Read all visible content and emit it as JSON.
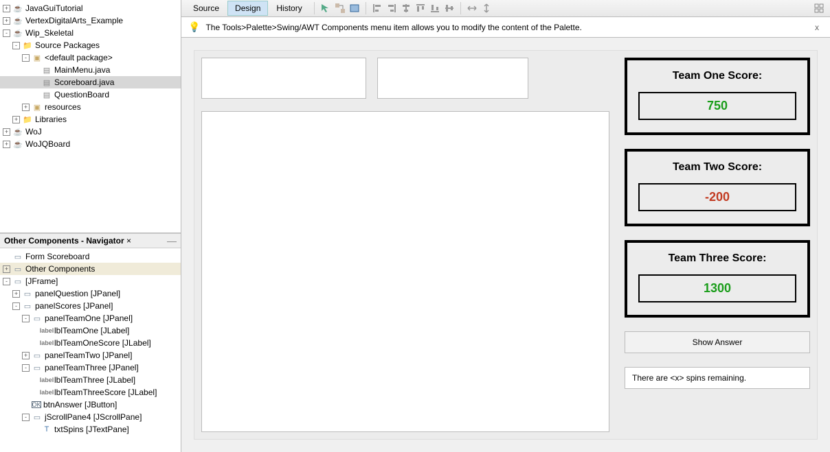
{
  "projects": {
    "items": [
      {
        "indent": 0,
        "toggle": "+",
        "icon": "java",
        "label": "JavaGuiTutorial"
      },
      {
        "indent": 0,
        "toggle": "+",
        "icon": "java",
        "label": "VertexDigitalArts_Example"
      },
      {
        "indent": 0,
        "toggle": "-",
        "icon": "java",
        "label": "Wip_Skeletal"
      },
      {
        "indent": 1,
        "toggle": "-",
        "icon": "folder",
        "label": "Source Packages"
      },
      {
        "indent": 2,
        "toggle": "-",
        "icon": "pkg",
        "label": "<default package>"
      },
      {
        "indent": 3,
        "toggle": "",
        "icon": "file",
        "label": "MainMenu.java"
      },
      {
        "indent": 3,
        "toggle": "",
        "icon": "file",
        "label": "Scoreboard.java",
        "selected": true
      },
      {
        "indent": 3,
        "toggle": "",
        "icon": "file",
        "label": "QuestionBoard"
      },
      {
        "indent": 2,
        "toggle": "+",
        "icon": "pkg",
        "label": "resources"
      },
      {
        "indent": 1,
        "toggle": "+",
        "icon": "folder",
        "label": "Libraries"
      },
      {
        "indent": 0,
        "toggle": "+",
        "icon": "java",
        "label": "WoJ"
      },
      {
        "indent": 0,
        "toggle": "+",
        "icon": "java",
        "label": "WoJQBoard"
      }
    ]
  },
  "navigator": {
    "title": "Other Components - Navigator",
    "items": [
      {
        "indent": 0,
        "toggle": "",
        "icon": "form",
        "label": "Form Scoreboard"
      },
      {
        "indent": 0,
        "toggle": "+",
        "icon": "form",
        "label": "Other Components",
        "selected": true
      },
      {
        "indent": 0,
        "toggle": "-",
        "icon": "form",
        "label": "[JFrame]"
      },
      {
        "indent": 1,
        "toggle": "+",
        "icon": "form",
        "label": "panelQuestion [JPanel]"
      },
      {
        "indent": 1,
        "toggle": "-",
        "icon": "form",
        "label": "panelScores [JPanel]"
      },
      {
        "indent": 2,
        "toggle": "-",
        "icon": "form",
        "label": "panelTeamOne [JPanel]"
      },
      {
        "indent": 3,
        "toggle": "",
        "icon": "label",
        "label": "lblTeamOne [JLabel]"
      },
      {
        "indent": 3,
        "toggle": "",
        "icon": "label",
        "label": "lblTeamOneScore [JLabel]"
      },
      {
        "indent": 2,
        "toggle": "+",
        "icon": "form",
        "label": "panelTeamTwo [JPanel]"
      },
      {
        "indent": 2,
        "toggle": "-",
        "icon": "form",
        "label": "panelTeamThree [JPanel]"
      },
      {
        "indent": 3,
        "toggle": "",
        "icon": "label",
        "label": "lblTeamThree [JLabel]"
      },
      {
        "indent": 3,
        "toggle": "",
        "icon": "label",
        "label": "lblTeamThreeScore [JLabel]"
      },
      {
        "indent": 2,
        "toggle": "",
        "icon": "btn",
        "label": "btnAnswer [JButton]"
      },
      {
        "indent": 2,
        "toggle": "-",
        "icon": "form",
        "label": "jScrollPane4 [JScrollPane]"
      },
      {
        "indent": 3,
        "toggle": "",
        "icon": "text",
        "label": "txtSpins [JTextPane]"
      }
    ]
  },
  "toolbar": {
    "tabs": {
      "source": "Source",
      "design": "Design",
      "history": "History"
    }
  },
  "tip": {
    "text": "The Tools>Palette>Swing/AWT Components menu item allows you to modify the content of the Palette.",
    "close": "x"
  },
  "form": {
    "team1": {
      "title": "Team One Score:",
      "value": "750"
    },
    "team2": {
      "title": "Team Two Score:",
      "value": "-200"
    },
    "team3": {
      "title": "Team Three Score:",
      "value": "1300"
    },
    "show_answer": "Show Answer",
    "spins": "There are <x> spins remaining."
  }
}
